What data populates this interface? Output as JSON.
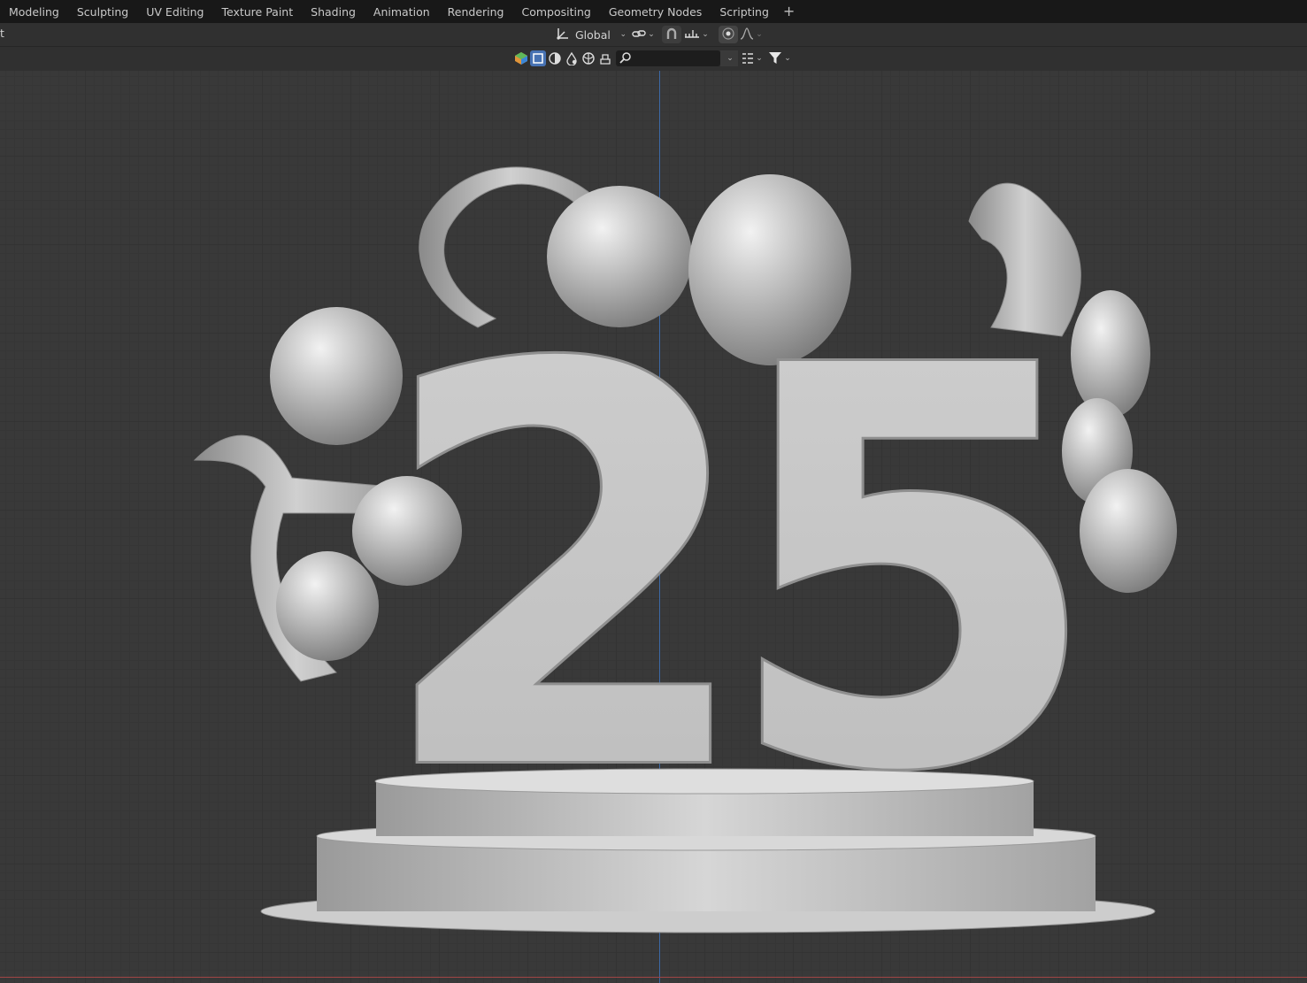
{
  "workspace_tabs": [
    "Modeling",
    "Sculpting",
    "UV Editing",
    "Texture Paint",
    "Shading",
    "Animation",
    "Rendering",
    "Compositing",
    "Geometry Nodes",
    "Scripting"
  ],
  "add_tab_label": "+",
  "header": {
    "mode_label_fragment": "t",
    "orientation_value": "Global"
  },
  "viewport": {
    "scene_text": "25",
    "grid": true
  },
  "colors": {
    "tabbar_bg": "#181818",
    "viewport_bg": "#393939",
    "z_axis": "#3d6aa8",
    "x_axis": "#a04545"
  },
  "icons": [
    "transform-orientation-icon",
    "pivot-link-icon",
    "snap-magnet-icon",
    "snap-increment-icon",
    "proportional-edit-icon",
    "falloff-curve-icon",
    "object-filter-icon",
    "selectable-icon",
    "viewport-visibility-icon",
    "render-visibility-icon",
    "holdout-icon",
    "indirect-only-icon",
    "search-icon",
    "filter-funnel-icon"
  ]
}
